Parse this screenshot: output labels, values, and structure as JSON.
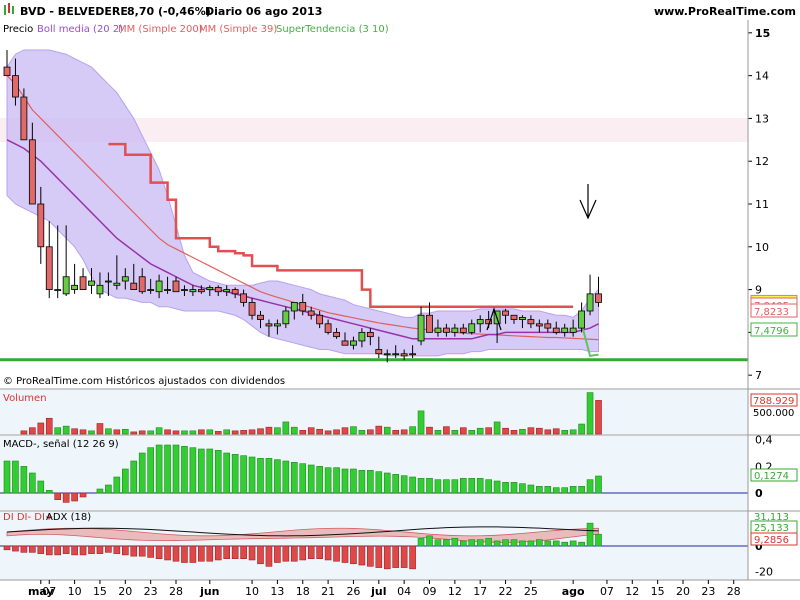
{
  "header": {
    "ticker": "BVD - BELVEDERE",
    "price_change": "8,70 (-0,46%)",
    "timeframe_date": "Diario  06 ago 2013",
    "site": "www.ProRealTime.com"
  },
  "legend": {
    "price": "Precio",
    "boll": "Boll media (20 2)",
    "mm200": "MM (Simple 200)",
    "mm39": "MM (Simple 39)",
    "supertrend": "SuperTendencia (3 10)"
  },
  "footer_note": "© ProRealTime.com  Históricos ajustados con dividendos",
  "colors": {
    "bull_candle": "#66cc44",
    "bear_candle": "#e06a6a",
    "boll_fill": "#c8b8f4",
    "boll_mid": "#9933aa",
    "mm200": "#e06060",
    "supertrend_bear": "#e05050",
    "supertrend_bull": "#5ec45e",
    "support": "#33aa33",
    "volume_up": "#33cc33",
    "volume_down": "#e04848",
    "macd_pos": "#33cc33",
    "adx_line": "#111111"
  },
  "chart_data": [
    {
      "type": "candlestick",
      "panel": "price",
      "x": [
        "2013-04-29",
        "2013-04-30",
        "2013-05-02",
        "2013-05-03",
        "2013-05-06",
        "2013-05-07",
        "2013-05-08",
        "2013-05-09",
        "2013-05-10",
        "2013-05-13",
        "2013-05-14",
        "2013-05-15",
        "2013-05-16",
        "2013-05-17",
        "2013-05-20",
        "2013-05-21",
        "2013-05-22",
        "2013-05-23",
        "2013-05-24",
        "2013-05-27",
        "2013-05-28",
        "2013-05-29",
        "2013-05-30",
        "2013-05-31",
        "2013-06-03",
        "2013-06-04",
        "2013-06-05",
        "2013-06-06",
        "2013-06-07",
        "2013-06-10",
        "2013-06-11",
        "2013-06-12",
        "2013-06-13",
        "2013-06-14",
        "2013-06-17",
        "2013-06-18",
        "2013-06-19",
        "2013-06-20",
        "2013-06-21",
        "2013-06-24",
        "2013-06-25",
        "2013-06-26",
        "2013-06-27",
        "2013-06-28",
        "2013-07-01",
        "2013-07-02",
        "2013-07-03",
        "2013-07-04",
        "2013-07-05",
        "2013-07-08",
        "2013-07-09",
        "2013-07-10",
        "2013-07-11",
        "2013-07-12",
        "2013-07-15",
        "2013-07-16",
        "2013-07-17",
        "2013-07-18",
        "2013-07-19",
        "2013-07-22",
        "2013-07-23",
        "2013-07-24",
        "2013-07-25",
        "2013-07-26",
        "2013-07-29",
        "2013-07-30",
        "2013-07-31",
        "2013-08-01",
        "2013-08-02",
        "2013-08-05",
        "2013-08-06"
      ],
      "open": [
        14.2,
        14.0,
        13.5,
        12.5,
        11.0,
        10.0,
        9.0,
        8.9,
        9.0,
        9.3,
        9.1,
        8.9,
        9.2,
        9.1,
        9.2,
        9.15,
        9.3,
        9.0,
        8.95,
        9.0,
        9.2,
        9.0,
        8.95,
        9.0,
        9.0,
        9.05,
        8.95,
        9.0,
        8.9,
        8.7,
        8.4,
        8.2,
        8.15,
        8.2,
        8.5,
        8.7,
        8.5,
        8.4,
        8.2,
        8.0,
        7.8,
        7.7,
        7.8,
        8.0,
        7.6,
        7.5,
        7.5,
        7.5,
        7.5,
        7.8,
        8.4,
        8.0,
        8.1,
        8.0,
        8.1,
        8.0,
        8.2,
        8.3,
        8.2,
        8.5,
        8.4,
        8.3,
        8.3,
        8.2,
        8.2,
        8.1,
        8.0,
        8.0,
        8.1,
        8.5,
        8.9
      ],
      "high": [
        14.6,
        14.4,
        13.7,
        12.9,
        11.4,
        10.6,
        10.5,
        10.5,
        9.6,
        9.5,
        9.5,
        9.4,
        9.4,
        9.8,
        9.5,
        9.6,
        9.5,
        9.25,
        9.35,
        9.3,
        9.3,
        9.1,
        9.1,
        9.1,
        9.1,
        9.1,
        9.1,
        9.05,
        9.0,
        8.8,
        8.5,
        8.3,
        8.3,
        8.6,
        8.7,
        8.9,
        8.6,
        8.5,
        8.3,
        8.1,
        8.0,
        7.9,
        8.1,
        8.1,
        7.9,
        7.6,
        7.7,
        7.6,
        7.7,
        8.6,
        8.7,
        8.3,
        8.2,
        8.2,
        8.2,
        8.3,
        8.4,
        8.5,
        8.5,
        8.55,
        8.4,
        8.4,
        8.4,
        8.3,
        8.3,
        8.25,
        8.2,
        8.3,
        8.7,
        9.35,
        9.3
      ],
      "low": [
        14.0,
        13.3,
        12.7,
        11.0,
        9.6,
        8.8,
        8.8,
        8.85,
        8.9,
        9.0,
        8.9,
        8.8,
        8.85,
        9.0,
        9.0,
        9.0,
        8.9,
        8.9,
        8.8,
        8.9,
        8.95,
        8.85,
        8.85,
        8.9,
        8.85,
        8.85,
        8.85,
        8.8,
        8.6,
        8.3,
        8.1,
        7.9,
        7.95,
        8.1,
        8.3,
        8.4,
        8.3,
        8.1,
        7.95,
        7.85,
        7.7,
        7.6,
        7.65,
        7.7,
        7.4,
        7.3,
        7.4,
        7.35,
        7.4,
        7.7,
        8.0,
        7.9,
        7.9,
        7.9,
        7.95,
        7.95,
        8.0,
        8.1,
        7.75,
        8.2,
        8.2,
        8.1,
        8.1,
        8.0,
        8.0,
        7.95,
        7.9,
        7.9,
        8.0,
        8.4,
        8.6
      ],
      "close": [
        14.0,
        13.5,
        12.5,
        11.0,
        10.0,
        9.0,
        9.0,
        9.3,
        9.1,
        9.0,
        9.2,
        9.1,
        9.2,
        9.15,
        9.3,
        9.0,
        8.95,
        9.0,
        9.2,
        9.0,
        8.95,
        9.0,
        9.0,
        8.95,
        9.05,
        8.95,
        9.0,
        8.9,
        8.7,
        8.4,
        8.3,
        8.15,
        8.2,
        8.5,
        8.7,
        8.5,
        8.4,
        8.2,
        8.0,
        7.9,
        7.7,
        7.8,
        8.0,
        7.9,
        7.5,
        7.5,
        7.5,
        7.45,
        7.5,
        8.4,
        8.0,
        8.1,
        8.0,
        8.1,
        8.0,
        8.2,
        8.3,
        8.2,
        8.5,
        8.4,
        8.3,
        8.35,
        8.2,
        8.15,
        8.1,
        8.0,
        8.1,
        8.1,
        8.5,
        8.9,
        8.7
      ],
      "boll_mid": [
        12.5,
        12.4,
        12.3,
        12.15,
        12.0,
        11.8,
        11.6,
        11.4,
        11.2,
        11.0,
        10.8,
        10.6,
        10.4,
        10.2,
        10.05,
        9.9,
        9.75,
        9.6,
        9.5,
        9.4,
        9.3,
        9.2,
        9.1,
        9.05,
        9.0,
        9.0,
        8.95,
        8.9,
        8.85,
        8.8,
        8.75,
        8.7,
        8.65,
        8.6,
        8.55,
        8.5,
        8.45,
        8.4,
        8.35,
        8.3,
        8.25,
        8.2,
        8.15,
        8.1,
        8.05,
        8.0,
        7.95,
        7.9,
        7.85,
        7.85,
        7.85,
        7.85,
        7.85,
        7.85,
        7.85,
        7.85,
        7.9,
        7.95,
        7.95,
        8.0,
        8.0,
        8.0,
        8.0,
        8.0,
        8.0,
        8.0,
        8.0,
        8.0,
        8.05,
        8.1,
        8.2
      ],
      "boll_upper": [
        14.2,
        14.5,
        14.6,
        14.6,
        14.6,
        14.6,
        14.55,
        14.5,
        14.4,
        14.3,
        14.2,
        14.0,
        13.8,
        13.6,
        13.3,
        13.0,
        12.6,
        12.2,
        11.8,
        11.2,
        10.5,
        9.8,
        9.4,
        9.3,
        9.2,
        9.15,
        9.1,
        9.1,
        9.1,
        9.1,
        9.15,
        9.2,
        9.2,
        9.15,
        9.1,
        9.05,
        9.0,
        8.9,
        8.85,
        8.8,
        8.75,
        8.65,
        8.6,
        8.55,
        8.5,
        8.45,
        8.4,
        8.35,
        8.35,
        8.45,
        8.45,
        8.5,
        8.5,
        8.5,
        8.5,
        8.5,
        8.55,
        8.55,
        8.55,
        8.55,
        8.55,
        8.5,
        8.5,
        8.5,
        8.45,
        8.4,
        8.4,
        8.35,
        8.5,
        8.8,
        9.0
      ],
      "boll_lower": [
        11.2,
        11.0,
        10.9,
        10.8,
        10.7,
        10.6,
        10.4,
        10.2,
        10.0,
        9.7,
        9.3,
        9.0,
        8.9,
        8.8,
        8.8,
        8.75,
        8.7,
        8.7,
        8.6,
        8.6,
        8.55,
        8.5,
        8.5,
        8.5,
        8.5,
        8.5,
        8.45,
        8.4,
        8.3,
        8.15,
        8.0,
        7.9,
        7.85,
        7.8,
        7.75,
        7.7,
        7.65,
        7.6,
        7.6,
        7.55,
        7.5,
        7.5,
        7.5,
        7.5,
        7.5,
        7.45,
        7.45,
        7.45,
        7.45,
        7.45,
        7.45,
        7.45,
        7.5,
        7.5,
        7.5,
        7.55,
        7.55,
        7.6,
        7.6,
        7.6,
        7.6,
        7.6,
        7.6,
        7.6,
        7.6,
        7.6,
        7.6,
        7.6,
        7.6,
        7.55,
        7.55
      ],
      "mm200": [
        14.0,
        13.8,
        13.5,
        13.2,
        13.0,
        12.8,
        12.6,
        12.4,
        12.2,
        12.0,
        11.8,
        11.6,
        11.4,
        11.2,
        11.0,
        10.8,
        10.6,
        10.4,
        10.2,
        10.05,
        9.95,
        9.85,
        9.75,
        9.65,
        9.55,
        9.45,
        9.35,
        9.25,
        9.15,
        9.05,
        8.95,
        8.88,
        8.82,
        8.76,
        8.7,
        8.64,
        8.58,
        8.52,
        8.46,
        8.42,
        8.38,
        8.34,
        8.3,
        8.26,
        8.22,
        8.19,
        8.16,
        8.13,
        8.1,
        8.08,
        8.06,
        8.04,
        8.02,
        8.0,
        7.98,
        7.97,
        7.96,
        7.95,
        7.94,
        7.93,
        7.92,
        7.91,
        7.9,
        7.89,
        7.88,
        7.88,
        7.87,
        7.86,
        7.85,
        7.84,
        7.83
      ],
      "supertrend": [
        null,
        null,
        null,
        null,
        null,
        null,
        null,
        null,
        null,
        null,
        null,
        null,
        12.4,
        12.4,
        12.15,
        12.15,
        12.15,
        11.5,
        11.5,
        11.1,
        10.2,
        10.2,
        10.2,
        10.2,
        10.0,
        9.9,
        9.9,
        9.85,
        9.8,
        9.55,
        9.55,
        9.55,
        9.45,
        9.45,
        9.45,
        9.45,
        9.45,
        9.45,
        9.45,
        9.45,
        9.45,
        9.45,
        9.0,
        8.6,
        8.6,
        8.6,
        8.6,
        8.6,
        8.6,
        8.6,
        8.6,
        8.6,
        8.6,
        8.6,
        8.6,
        8.6,
        8.6,
        8.6,
        8.6,
        8.6,
        8.6,
        8.6,
        8.6,
        8.6,
        8.6,
        8.6,
        8.6,
        8.6,
        7.5,
        7.45,
        7.48
      ],
      "support_level": 7.36,
      "ylim": [
        6.7,
        15.3
      ],
      "y_ticks": [
        7,
        8,
        9,
        10,
        11,
        12,
        13,
        14,
        15
      ],
      "right_labels": {
        "close": "8,70",
        "mm200": "7,8233",
        "boll_mid": "7,8405",
        "supertrend": "7,4796"
      },
      "annotations": [
        "down-arrow",
        "caret-up"
      ]
    },
    {
      "type": "bar",
      "panel": "volume",
      "title": "Volumen",
      "values": [
        0,
        0,
        60,
        120,
        210,
        300,
        120,
        150,
        100,
        80,
        60,
        200,
        100,
        80,
        90,
        40,
        60,
        60,
        120,
        80,
        60,
        60,
        60,
        80,
        80,
        50,
        80,
        60,
        70,
        80,
        100,
        130,
        120,
        230,
        130,
        70,
        120,
        90,
        60,
        80,
        120,
        140,
        70,
        80,
        150,
        130,
        70,
        80,
        140,
        440,
        130,
        70,
        140,
        70,
        120,
        70,
        110,
        120,
        230,
        110,
        70,
        90,
        120,
        110,
        80,
        100,
        70,
        80,
        190,
        788.929,
        640
      ],
      "up": [
        false,
        false,
        false,
        false,
        false,
        false,
        true,
        true,
        false,
        false,
        true,
        false,
        true,
        false,
        true,
        false,
        false,
        true,
        true,
        false,
        false,
        true,
        true,
        false,
        true,
        false,
        true,
        false,
        false,
        false,
        false,
        false,
        true,
        true,
        true,
        false,
        false,
        false,
        false,
        false,
        false,
        true,
        true,
        false,
        false,
        true,
        false,
        false,
        true,
        true,
        false,
        true,
        false,
        true,
        false,
        true,
        true,
        false,
        true,
        false,
        false,
        true,
        false,
        false,
        false,
        false,
        true,
        true,
        true,
        true,
        false
      ],
      "right_labels": [
        "788.929",
        "500.000"
      ]
    },
    {
      "type": "bar",
      "panel": "macd",
      "title": "MACD-, señal (12 26 9)",
      "values": [
        0.24,
        0.24,
        0.2,
        0.15,
        0.09,
        0.02,
        -0.05,
        -0.07,
        -0.06,
        -0.03,
        0,
        0.03,
        0.06,
        0.12,
        0.18,
        0.24,
        0.3,
        0.34,
        0.36,
        0.36,
        0.36,
        0.35,
        0.34,
        0.33,
        0.33,
        0.32,
        0.3,
        0.29,
        0.28,
        0.27,
        0.26,
        0.26,
        0.25,
        0.24,
        0.23,
        0.22,
        0.21,
        0.2,
        0.19,
        0.19,
        0.18,
        0.18,
        0.17,
        0.17,
        0.16,
        0.15,
        0.14,
        0.13,
        0.12,
        0.11,
        0.11,
        0.1,
        0.1,
        0.1,
        0.11,
        0.11,
        0.11,
        0.1,
        0.09,
        0.08,
        0.08,
        0.07,
        0.06,
        0.05,
        0.05,
        0.04,
        0.04,
        0.05,
        0.05,
        0.1,
        0.1274
      ],
      "ylim": [
        -0.12,
        0.42
      ],
      "y_ticks": [
        0,
        0.2,
        0.4
      ],
      "tick_labels": [
        "0",
        "0,2",
        "0,4"
      ],
      "right_labels": [
        "0,1274"
      ]
    },
    {
      "type": "bar",
      "panel": "dmi",
      "title": "DI DI- DI+",
      "adx_label": "ADX (18)",
      "values": [
        -3,
        -4,
        -5,
        -5,
        -6,
        -7,
        -7,
        -6,
        -7,
        -7,
        -6,
        -6,
        -5,
        -6,
        -7,
        -8,
        -8,
        -9,
        -10,
        -11,
        -12,
        -13,
        -13,
        -12,
        -12,
        -11,
        -10,
        -10,
        -10,
        -11,
        -14,
        -16,
        -13,
        -12,
        -12,
        -11,
        -10,
        -10,
        -11,
        -12,
        -13,
        -14,
        -15,
        -16,
        -17,
        -18,
        -17,
        -17,
        -18,
        6,
        8,
        5,
        5,
        6,
        4,
        5,
        5,
        6,
        4,
        5,
        5,
        4,
        4,
        5,
        4,
        4,
        3,
        4,
        3,
        18,
        9.2856
      ],
      "ylim": [
        -26,
        26
      ],
      "y_ticks": [
        0,
        -20
      ],
      "tick_labels": [
        "0",
        "-20"
      ],
      "right_labels": [
        "31,113",
        "25,133",
        "9,2856"
      ]
    }
  ],
  "x_axis": {
    "ticks": [
      {
        "label": "may",
        "bold": true,
        "i": 4
      },
      {
        "label": "07",
        "i": 5
      },
      {
        "label": "10",
        "i": 8
      },
      {
        "label": "15",
        "i": 11
      },
      {
        "label": "20",
        "i": 14
      },
      {
        "label": "23",
        "i": 17
      },
      {
        "label": "28",
        "i": 20
      },
      {
        "label": "jun",
        "bold": true,
        "i": 24
      },
      {
        "label": "10",
        "i": 29
      },
      {
        "label": "13",
        "i": 32
      },
      {
        "label": "18",
        "i": 35
      },
      {
        "label": "21",
        "i": 38
      },
      {
        "label": "26",
        "i": 41
      },
      {
        "label": "jul",
        "bold": true,
        "i": 44
      },
      {
        "label": "04",
        "i": 47
      },
      {
        "label": "09",
        "i": 50
      },
      {
        "label": "12",
        "i": 53
      },
      {
        "label": "17",
        "i": 56
      },
      {
        "label": "22",
        "i": 59
      },
      {
        "label": "25",
        "i": 62
      },
      {
        "label": "ago",
        "bold": true,
        "i": 67
      },
      {
        "label": "07",
        "i": 71
      },
      {
        "label": "12",
        "i": 74
      },
      {
        "label": "15",
        "i": 77
      },
      {
        "label": "20",
        "i": 80
      },
      {
        "label": "23",
        "i": 83
      },
      {
        "label": "28",
        "i": 86
      }
    ]
  }
}
